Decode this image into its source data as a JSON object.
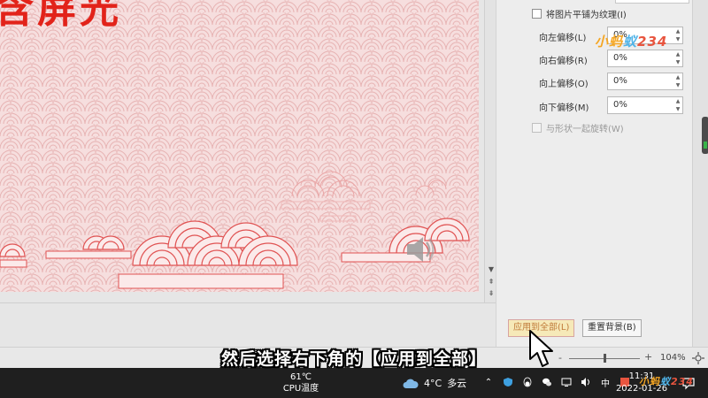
{
  "slide": {
    "title_fragment": "含屏光",
    "background_color": "#f6dede",
    "pattern_color": "#e9b7b7",
    "accent_color": "#e04848"
  },
  "format_background_panel": {
    "tile_checkbox_label": "将图片平铺为纹理(I)",
    "tile_checked": false,
    "offsets": [
      {
        "label": "向左偏移(L)",
        "value": "0%"
      },
      {
        "label": "向右偏移(R)",
        "value": "0%"
      },
      {
        "label": "向上偏移(O)",
        "value": "0%"
      },
      {
        "label": "向下偏移(M)",
        "value": "0%"
      }
    ],
    "rotate_checkbox_label": "与形状一起旋转(W)",
    "rotate_enabled": false,
    "apply_all_button": "应用到全部(L)",
    "reset_button": "重置背景(B)"
  },
  "statusbar": {
    "zoom_minus": "-",
    "zoom_plus": "+",
    "zoom_value": "104%",
    "zoom_level": 104
  },
  "taskbar": {
    "cpu_temp_value": "61℃",
    "cpu_temp_label": "CPU温度",
    "weather_temp": "4°C",
    "weather_text": "多云",
    "ime_label": "中",
    "clock_time": "11:31",
    "clock_date": "2022-01-26"
  },
  "caption": {
    "text": "然后选择右下角的【应用到全部】"
  },
  "watermark": {
    "text": "小蚂蚁234",
    "color_a": "#f5a623",
    "color_b": "#4fb3e8"
  },
  "colors": {
    "taskbar_bg": "#1f1f1f",
    "panel_bg": "#ededed",
    "apply_button_bg": "#f6e9b8"
  }
}
